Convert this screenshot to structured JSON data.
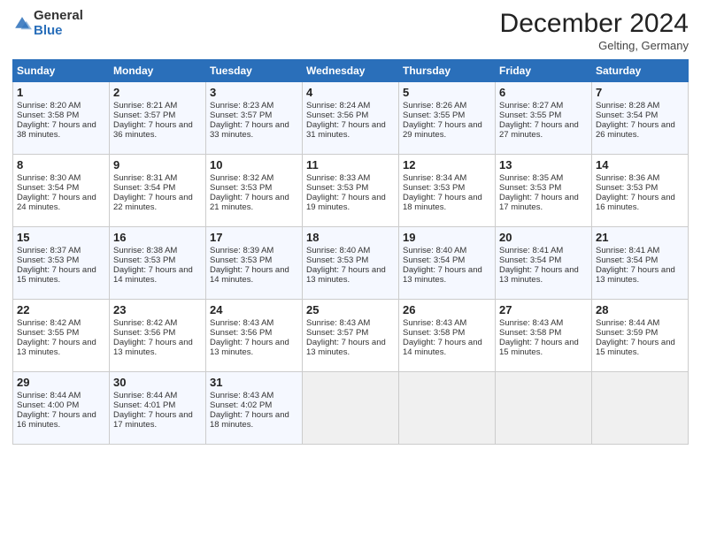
{
  "logo": {
    "general": "General",
    "blue": "Blue"
  },
  "header": {
    "month": "December 2024",
    "location": "Gelting, Germany"
  },
  "days_of_week": [
    "Sunday",
    "Monday",
    "Tuesday",
    "Wednesday",
    "Thursday",
    "Friday",
    "Saturday"
  ],
  "weeks": [
    [
      {
        "day": "1",
        "sunrise": "Sunrise: 8:20 AM",
        "sunset": "Sunset: 3:58 PM",
        "daylight": "Daylight: 7 hours and 38 minutes."
      },
      {
        "day": "2",
        "sunrise": "Sunrise: 8:21 AM",
        "sunset": "Sunset: 3:57 PM",
        "daylight": "Daylight: 7 hours and 36 minutes."
      },
      {
        "day": "3",
        "sunrise": "Sunrise: 8:23 AM",
        "sunset": "Sunset: 3:57 PM",
        "daylight": "Daylight: 7 hours and 33 minutes."
      },
      {
        "day": "4",
        "sunrise": "Sunrise: 8:24 AM",
        "sunset": "Sunset: 3:56 PM",
        "daylight": "Daylight: 7 hours and 31 minutes."
      },
      {
        "day": "5",
        "sunrise": "Sunrise: 8:26 AM",
        "sunset": "Sunset: 3:55 PM",
        "daylight": "Daylight: 7 hours and 29 minutes."
      },
      {
        "day": "6",
        "sunrise": "Sunrise: 8:27 AM",
        "sunset": "Sunset: 3:55 PM",
        "daylight": "Daylight: 7 hours and 27 minutes."
      },
      {
        "day": "7",
        "sunrise": "Sunrise: 8:28 AM",
        "sunset": "Sunset: 3:54 PM",
        "daylight": "Daylight: 7 hours and 26 minutes."
      }
    ],
    [
      {
        "day": "8",
        "sunrise": "Sunrise: 8:30 AM",
        "sunset": "Sunset: 3:54 PM",
        "daylight": "Daylight: 7 hours and 24 minutes."
      },
      {
        "day": "9",
        "sunrise": "Sunrise: 8:31 AM",
        "sunset": "Sunset: 3:54 PM",
        "daylight": "Daylight: 7 hours and 22 minutes."
      },
      {
        "day": "10",
        "sunrise": "Sunrise: 8:32 AM",
        "sunset": "Sunset: 3:53 PM",
        "daylight": "Daylight: 7 hours and 21 minutes."
      },
      {
        "day": "11",
        "sunrise": "Sunrise: 8:33 AM",
        "sunset": "Sunset: 3:53 PM",
        "daylight": "Daylight: 7 hours and 19 minutes."
      },
      {
        "day": "12",
        "sunrise": "Sunrise: 8:34 AM",
        "sunset": "Sunset: 3:53 PM",
        "daylight": "Daylight: 7 hours and 18 minutes."
      },
      {
        "day": "13",
        "sunrise": "Sunrise: 8:35 AM",
        "sunset": "Sunset: 3:53 PM",
        "daylight": "Daylight: 7 hours and 17 minutes."
      },
      {
        "day": "14",
        "sunrise": "Sunrise: 8:36 AM",
        "sunset": "Sunset: 3:53 PM",
        "daylight": "Daylight: 7 hours and 16 minutes."
      }
    ],
    [
      {
        "day": "15",
        "sunrise": "Sunrise: 8:37 AM",
        "sunset": "Sunset: 3:53 PM",
        "daylight": "Daylight: 7 hours and 15 minutes."
      },
      {
        "day": "16",
        "sunrise": "Sunrise: 8:38 AM",
        "sunset": "Sunset: 3:53 PM",
        "daylight": "Daylight: 7 hours and 14 minutes."
      },
      {
        "day": "17",
        "sunrise": "Sunrise: 8:39 AM",
        "sunset": "Sunset: 3:53 PM",
        "daylight": "Daylight: 7 hours and 14 minutes."
      },
      {
        "day": "18",
        "sunrise": "Sunrise: 8:40 AM",
        "sunset": "Sunset: 3:53 PM",
        "daylight": "Daylight: 7 hours and 13 minutes."
      },
      {
        "day": "19",
        "sunrise": "Sunrise: 8:40 AM",
        "sunset": "Sunset: 3:54 PM",
        "daylight": "Daylight: 7 hours and 13 minutes."
      },
      {
        "day": "20",
        "sunrise": "Sunrise: 8:41 AM",
        "sunset": "Sunset: 3:54 PM",
        "daylight": "Daylight: 7 hours and 13 minutes."
      },
      {
        "day": "21",
        "sunrise": "Sunrise: 8:41 AM",
        "sunset": "Sunset: 3:54 PM",
        "daylight": "Daylight: 7 hours and 13 minutes."
      }
    ],
    [
      {
        "day": "22",
        "sunrise": "Sunrise: 8:42 AM",
        "sunset": "Sunset: 3:55 PM",
        "daylight": "Daylight: 7 hours and 13 minutes."
      },
      {
        "day": "23",
        "sunrise": "Sunrise: 8:42 AM",
        "sunset": "Sunset: 3:56 PM",
        "daylight": "Daylight: 7 hours and 13 minutes."
      },
      {
        "day": "24",
        "sunrise": "Sunrise: 8:43 AM",
        "sunset": "Sunset: 3:56 PM",
        "daylight": "Daylight: 7 hours and 13 minutes."
      },
      {
        "day": "25",
        "sunrise": "Sunrise: 8:43 AM",
        "sunset": "Sunset: 3:57 PM",
        "daylight": "Daylight: 7 hours and 13 minutes."
      },
      {
        "day": "26",
        "sunrise": "Sunrise: 8:43 AM",
        "sunset": "Sunset: 3:58 PM",
        "daylight": "Daylight: 7 hours and 14 minutes."
      },
      {
        "day": "27",
        "sunrise": "Sunrise: 8:43 AM",
        "sunset": "Sunset: 3:58 PM",
        "daylight": "Daylight: 7 hours and 15 minutes."
      },
      {
        "day": "28",
        "sunrise": "Sunrise: 8:44 AM",
        "sunset": "Sunset: 3:59 PM",
        "daylight": "Daylight: 7 hours and 15 minutes."
      }
    ],
    [
      {
        "day": "29",
        "sunrise": "Sunrise: 8:44 AM",
        "sunset": "Sunset: 4:00 PM",
        "daylight": "Daylight: 7 hours and 16 minutes."
      },
      {
        "day": "30",
        "sunrise": "Sunrise: 8:44 AM",
        "sunset": "Sunset: 4:01 PM",
        "daylight": "Daylight: 7 hours and 17 minutes."
      },
      {
        "day": "31",
        "sunrise": "Sunrise: 8:43 AM",
        "sunset": "Sunset: 4:02 PM",
        "daylight": "Daylight: 7 hours and 18 minutes."
      },
      null,
      null,
      null,
      null
    ]
  ]
}
